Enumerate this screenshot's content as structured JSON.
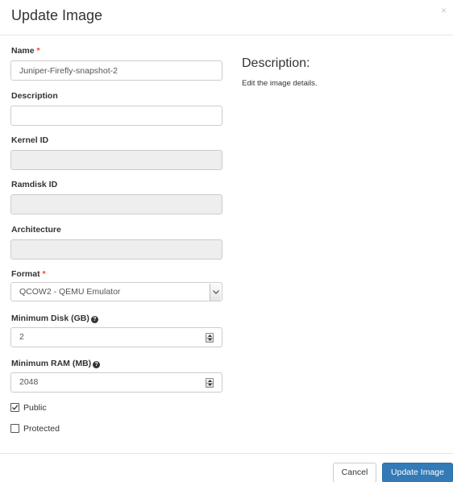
{
  "header": {
    "title": "Update Image",
    "close": "×"
  },
  "form": {
    "name": {
      "label": "Name",
      "required": "*",
      "value": "Juniper-Firefly-snapshot-2"
    },
    "description": {
      "label": "Description",
      "value": ""
    },
    "kernel_id": {
      "label": "Kernel ID",
      "value": ""
    },
    "ramdisk_id": {
      "label": "Ramdisk ID",
      "value": ""
    },
    "architecture": {
      "label": "Architecture",
      "value": ""
    },
    "format": {
      "label": "Format",
      "required": "*",
      "selected": "QCOW2 - QEMU Emulator"
    },
    "min_disk": {
      "label": "Minimum Disk (GB)",
      "help": "?",
      "value": "2"
    },
    "min_ram": {
      "label": "Minimum RAM (MB)",
      "help": "?",
      "value": "2048"
    },
    "public": {
      "label": "Public",
      "checked": true
    },
    "protected": {
      "label": "Protected",
      "checked": false
    }
  },
  "side": {
    "title": "Description:",
    "text": "Edit the image details."
  },
  "footer": {
    "cancel_label": "Cancel",
    "submit_label": "Update Image"
  },
  "colors": {
    "primary": "#337ab7",
    "required": "#ff3b3b",
    "disabled_bg": "#eeeeee"
  }
}
